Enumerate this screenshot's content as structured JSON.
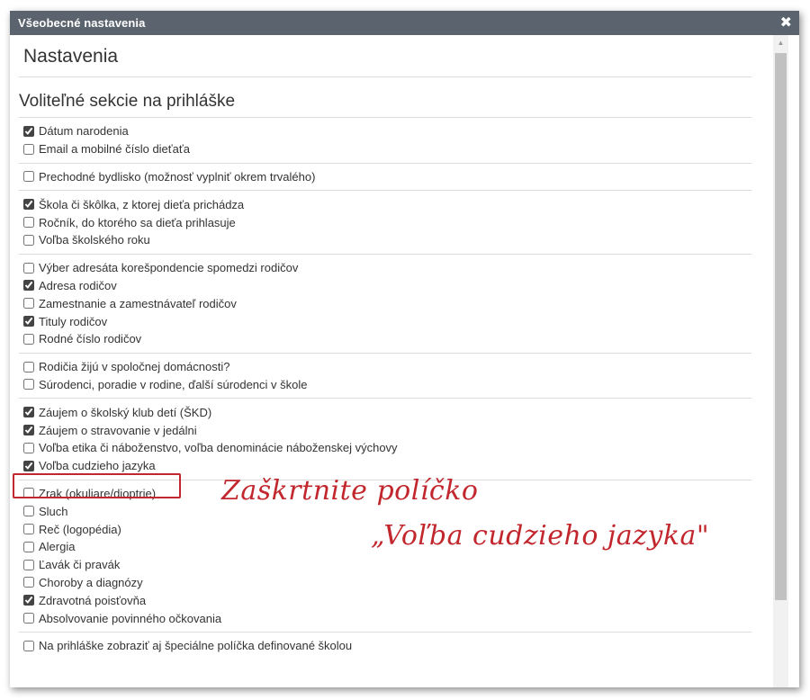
{
  "dialog": {
    "title": "Všeobecné nastavenia",
    "close_symbol": "✖",
    "heading": "Nastavenia",
    "section_title": "Voliteľné sekcie na prihláške"
  },
  "groups": [
    {
      "options": [
        {
          "label": "Dátum narodenia",
          "checked": true
        },
        {
          "label": "Email a mobilné číslo dieťaťa",
          "checked": false
        }
      ]
    },
    {
      "options": [
        {
          "label": "Prechodné bydlisko (možnosť vyplniť okrem trvalého)",
          "checked": false
        }
      ]
    },
    {
      "options": [
        {
          "label": "Škola či škôlka, z ktorej dieťa prichádza",
          "checked": true
        },
        {
          "label": "Ročník, do ktorého sa dieťa prihlasuje",
          "checked": false
        },
        {
          "label": "Voľba školského roku",
          "checked": false
        }
      ]
    },
    {
      "options": [
        {
          "label": "Výber adresáta korešpondencie spomedzi rodičov",
          "checked": false
        },
        {
          "label": "Adresa rodičov",
          "checked": true
        },
        {
          "label": "Zamestnanie a zamestnávateľ rodičov",
          "checked": false
        },
        {
          "label": "Tituly rodičov",
          "checked": true
        },
        {
          "label": "Rodné číslo rodičov",
          "checked": false
        }
      ]
    },
    {
      "options": [
        {
          "label": "Rodičia žijú v spoločnej domácnosti?",
          "checked": false
        },
        {
          "label": "Súrodenci, poradie v rodine, ďalší súrodenci v škole",
          "checked": false
        }
      ]
    },
    {
      "options": [
        {
          "label": "Záujem o školský klub detí (ŠKD)",
          "checked": true
        },
        {
          "label": "Záujem o stravovanie v jedálni",
          "checked": true
        },
        {
          "label": "Voľba etika či náboženstvo, voľba denominácie náboženskej výchovy",
          "checked": false
        },
        {
          "label": "Voľba cudzieho jazyka",
          "checked": true
        }
      ]
    },
    {
      "options": [
        {
          "label": "Zrak (okuliare/dioptrie)",
          "checked": false
        },
        {
          "label": "Sluch",
          "checked": false
        },
        {
          "label": "Reč (logopédia)",
          "checked": false
        },
        {
          "label": "Alergia",
          "checked": false
        },
        {
          "label": "Ľavák či pravák",
          "checked": false
        },
        {
          "label": "Choroby a diagnózy",
          "checked": false
        },
        {
          "label": "Zdravotná poisťovňa",
          "checked": true
        },
        {
          "label": "Absolvovanie povinného očkovania",
          "checked": false
        }
      ]
    },
    {
      "options": [
        {
          "label": "Na prihláške zobraziť aj špeciálne políčka definované školou",
          "checked": false
        }
      ]
    }
  ],
  "annotation": {
    "line1": "Zaškrtnite políčko",
    "line2": "„Voľba cudzieho jazyka\"",
    "color": "#c1272d"
  },
  "colors": {
    "titlebar": "#5b646e",
    "text": "#333333",
    "divider": "#dcdcdc"
  }
}
